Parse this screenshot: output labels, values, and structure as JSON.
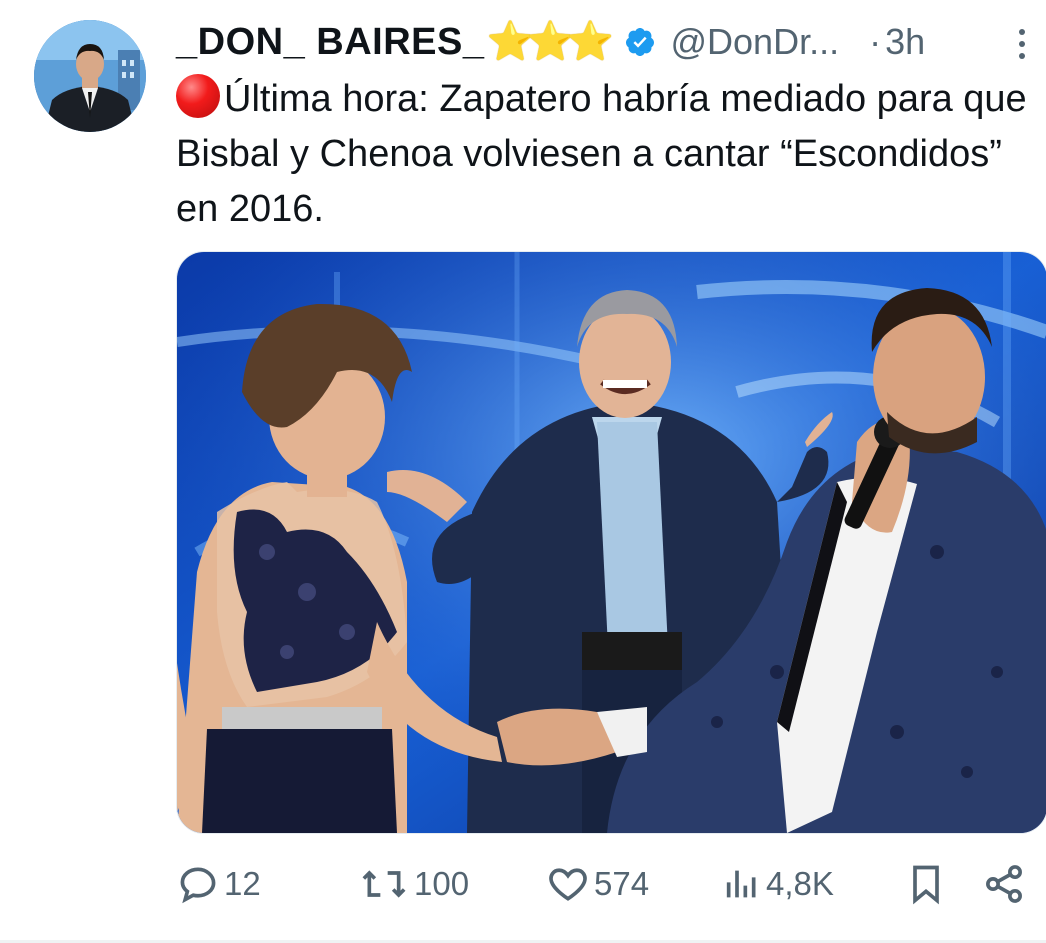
{
  "author": {
    "display_name": "_DON_ BAIRES_",
    "stars": [
      "⭐",
      "⭐",
      "⭐"
    ],
    "verified_icon": "verified-badge-icon",
    "handle": "@DonDr...",
    "separator": "·",
    "time": "3h"
  },
  "tweet": {
    "emoji_icon": "red-circle-icon",
    "text": "Última hora: Zapatero habría mediado para que Bisbal y Chenoa volviesen a cantar “Escondidos” en 2016."
  },
  "media": {
    "type": "photo",
    "icon": "photo-image"
  },
  "actions": {
    "replies": "12",
    "reposts": "100",
    "likes": "574",
    "views": "4,8K",
    "icons": [
      "reply-icon",
      "repost-icon",
      "like-icon",
      "views-icon",
      "bookmark-icon",
      "share-icon"
    ]
  },
  "colors": {
    "text": "#0f1419",
    "secondary": "#536471",
    "verified": "#1d9bf0",
    "star": "#f5c518"
  }
}
